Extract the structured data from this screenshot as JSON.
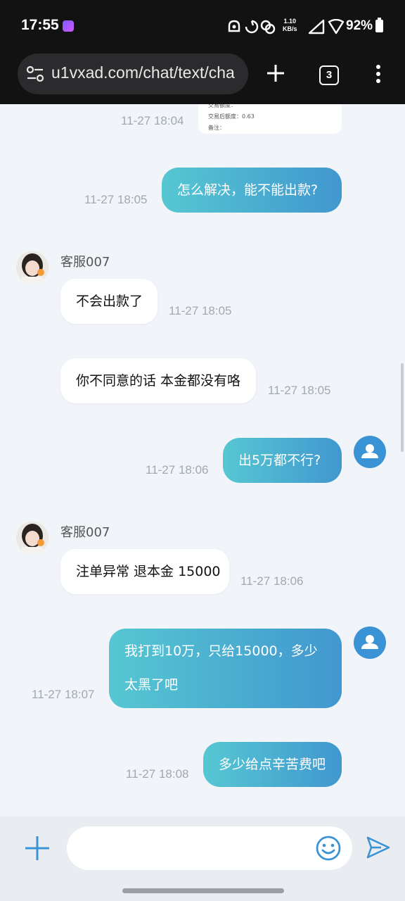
{
  "status_bar": {
    "time": "17:55",
    "net_speed_value": "1.10",
    "net_speed_unit": "KB/s",
    "battery": "92%"
  },
  "browser": {
    "url": "u1vxad.com/chat/text/cha",
    "tab_count": "3"
  },
  "receipt": {
    "line1": "交易额度：",
    "line2": "交易后额度：0.63",
    "line3": "备注："
  },
  "messages": [
    {
      "id": "m0",
      "direction": "out",
      "time": "11-27 18:04",
      "text": ""
    },
    {
      "id": "m1",
      "direction": "out",
      "time": "11-27 18:05",
      "text": "怎么解决，能不能出款?"
    },
    {
      "id": "m2",
      "direction": "in",
      "sender": "客服007",
      "time": "11-27 18:05",
      "text": "不会出款了"
    },
    {
      "id": "m3",
      "direction": "in",
      "time": "11-27 18:05",
      "text": "你不同意的话 本金都没有咯"
    },
    {
      "id": "m4",
      "direction": "out",
      "time": "11-27 18:06",
      "text": "出5万都不行?"
    },
    {
      "id": "m5",
      "direction": "in",
      "sender": "客服007",
      "time": "11-27 18:06",
      "text": "注单异常 退本金 15000"
    },
    {
      "id": "m6",
      "direction": "out",
      "time": "11-27 18:07",
      "text": "我打到10万，只给15000，多少太黑了吧"
    },
    {
      "id": "m7",
      "direction": "out",
      "time": "11-27 18:08",
      "text": "多少给点辛苦费吧"
    }
  ],
  "composer": {
    "placeholder": ""
  },
  "icons": {
    "site_settings": "tune-icon",
    "new_tab": "plus-icon",
    "menu": "more-vert-icon",
    "attach": "plus-icon",
    "emoji": "smiley-icon",
    "send": "send-icon",
    "agent_avatar": "girl-avatar",
    "user_avatar": "person-icon"
  },
  "colors": {
    "accent": "#3a93d5",
    "bubble_out_start": "#56c7d2",
    "bubble_out_end": "#4197cf"
  }
}
